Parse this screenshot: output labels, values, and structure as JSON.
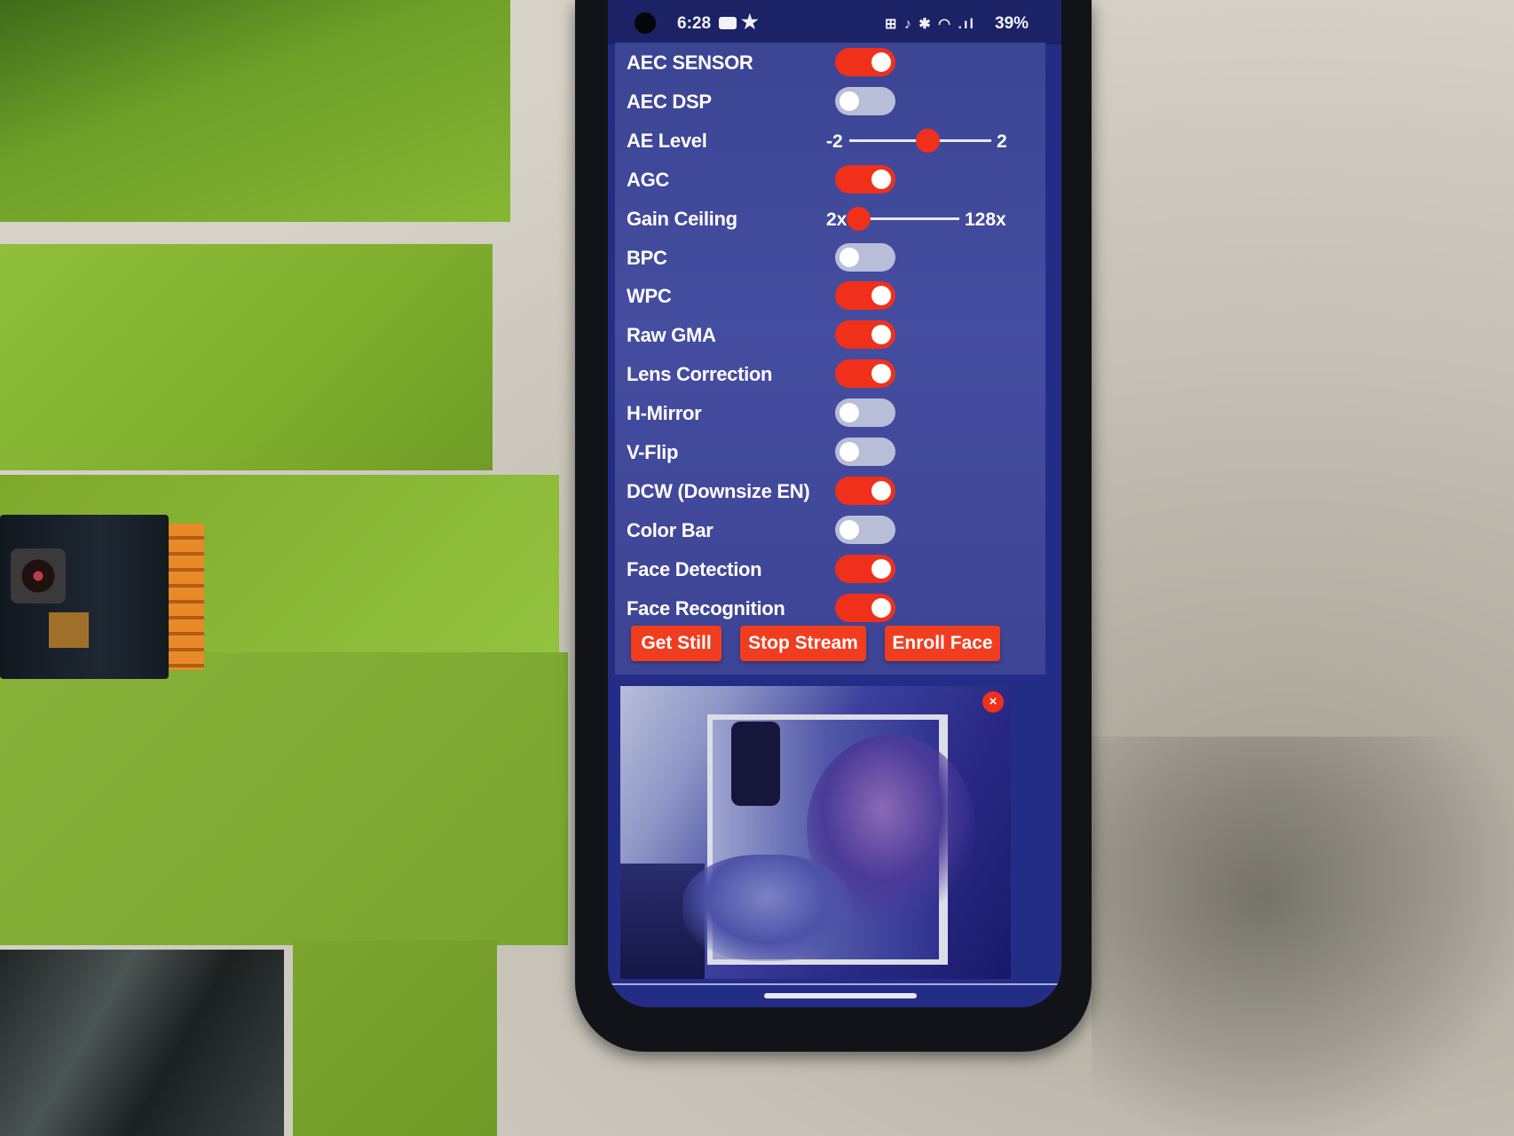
{
  "status_bar": {
    "time": "6:28",
    "icons": "⊞ ♪ ✱ ◠ .ıl",
    "battery": "39%"
  },
  "settings": [
    {
      "label": "AEC SENSOR",
      "type": "toggle",
      "on": true
    },
    {
      "label": "AEC DSP",
      "type": "toggle",
      "on": false
    },
    {
      "label": "AE Level",
      "type": "slider",
      "min_label": "-2",
      "max_label": "2",
      "min": -2,
      "max": 2,
      "value": 1
    },
    {
      "label": "AGC",
      "type": "toggle",
      "on": true
    },
    {
      "label": "Gain Ceiling",
      "type": "slider",
      "min_label": "2x",
      "max_label": "128x",
      "min": 0,
      "max": 6,
      "value": 0
    },
    {
      "label": "BPC",
      "type": "toggle",
      "on": false
    },
    {
      "label": "WPC",
      "type": "toggle",
      "on": true
    },
    {
      "label": "Raw GMA",
      "type": "toggle",
      "on": true
    },
    {
      "label": "Lens Correction",
      "type": "toggle",
      "on": true
    },
    {
      "label": "H-Mirror",
      "type": "toggle",
      "on": false
    },
    {
      "label": "V-Flip",
      "type": "toggle",
      "on": false
    },
    {
      "label": "DCW (Downsize EN)",
      "type": "toggle",
      "on": true
    },
    {
      "label": "Color Bar",
      "type": "toggle",
      "on": false
    },
    {
      "label": "Face Detection",
      "type": "toggle",
      "on": true
    },
    {
      "label": "Face Recognition",
      "type": "toggle",
      "on": true
    }
  ],
  "buttons": {
    "get_still": "Get Still",
    "stop_stream": "Stop Stream",
    "enroll_face": "Enroll Face"
  },
  "stream": {
    "close_glyph": "×"
  },
  "colors": {
    "accent": "#f0301a",
    "toggle_off": "#b8bed8",
    "panel": "#454da0"
  }
}
